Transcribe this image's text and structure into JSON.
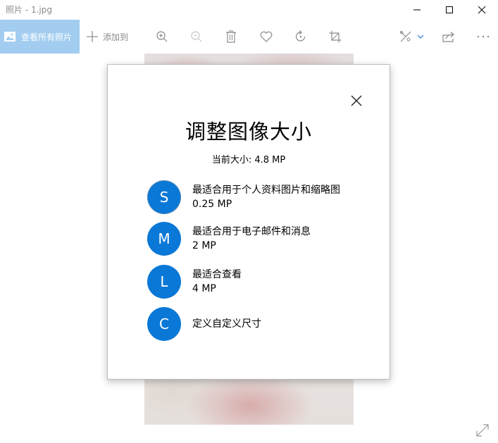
{
  "window": {
    "title": "照片 - 1.jpg"
  },
  "toolbar": {
    "view_all_label": "查看所有照片",
    "add_to_label": "添加到"
  },
  "dialog": {
    "title": "调整图像大小",
    "current_size": "当前大小: 4.8 MP",
    "options": [
      {
        "letter": "S",
        "title": "最适合用于个人资料图片和缩略图",
        "size": "0.25 MP"
      },
      {
        "letter": "M",
        "title": "最适合用于电子邮件和消息",
        "size": "2 MP"
      },
      {
        "letter": "L",
        "title": "最适合查看",
        "size": "4 MP"
      },
      {
        "letter": "C",
        "title": "定义自定义尺寸",
        "size": ""
      }
    ]
  },
  "colors": {
    "accent": "#0a78d6",
    "view_all_bg": "#a3cdf0",
    "muted_text": "#8a8a8a"
  },
  "icons": [
    "picture-icon",
    "plus-icon",
    "zoom-in-icon",
    "zoom-out-icon",
    "delete-icon",
    "heart-icon",
    "rotate-icon",
    "crop-icon",
    "edit-icon",
    "chevron-down-icon",
    "share-icon",
    "more-icon",
    "minimize-icon",
    "maximize-icon",
    "close-icon",
    "fit-to-window-icon"
  ]
}
